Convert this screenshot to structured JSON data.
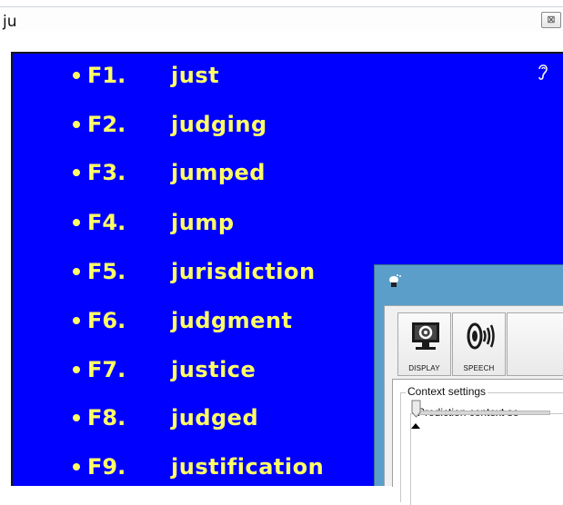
{
  "search": {
    "query": "ju",
    "close_glyph": "⊠"
  },
  "predictions": [
    {
      "key": "F1.",
      "word": "just"
    },
    {
      "key": "F2.",
      "word": "judging"
    },
    {
      "key": "F3.",
      "word": "jumped"
    },
    {
      "key": "F4.",
      "word": "jump"
    },
    {
      "key": "F5.",
      "word": "jurisdiction"
    },
    {
      "key": "F6.",
      "word": "judgment"
    },
    {
      "key": "F7.",
      "word": "justice"
    },
    {
      "key": "F8.",
      "word": "judged"
    },
    {
      "key": "F9.",
      "word": "justification"
    }
  ],
  "list_icons": {
    "speak": "ear-icon"
  },
  "settings": {
    "toolbar": [
      {
        "label": "DISPLAY",
        "icon": "monitor-gear-icon"
      },
      {
        "label": "SPEECH",
        "icon": "speaker-waves-icon"
      }
    ],
    "group_label": "Context settings",
    "subgroup_label": "Prediction context se"
  },
  "colors": {
    "list_bg": "#0000ff",
    "text": "#ffff66",
    "window_title": "#5b9ec9"
  }
}
